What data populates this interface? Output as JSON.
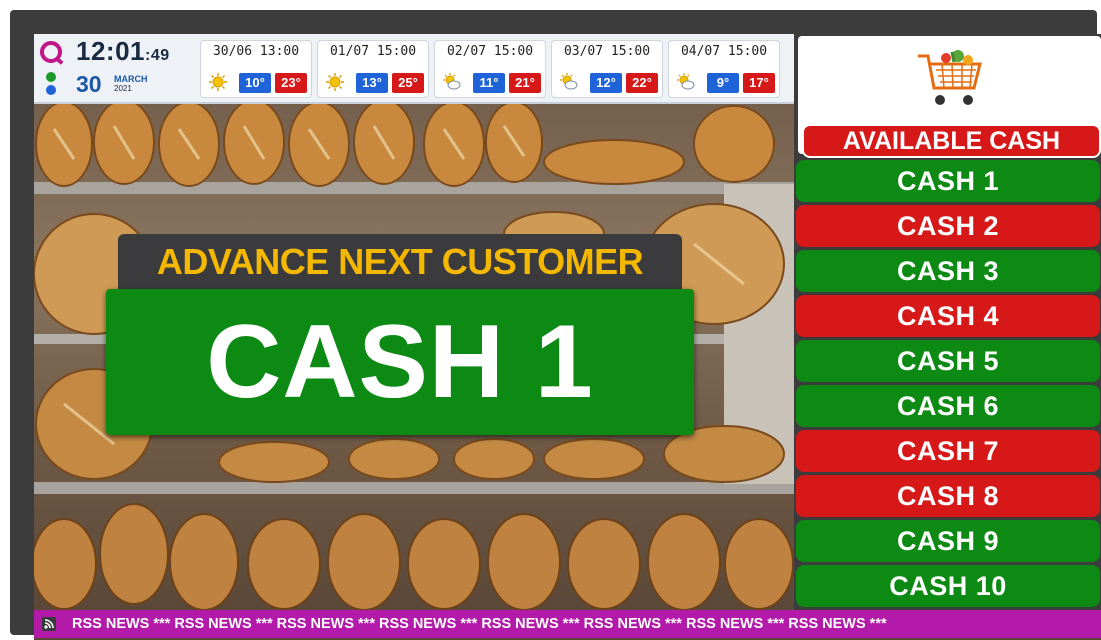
{
  "clock": {
    "time": "12:01",
    "seconds": ":49",
    "day": "30",
    "month": "MARCH",
    "year": "2021"
  },
  "forecast": [
    {
      "date": "30/06  13:00",
      "icon": "sun-icon",
      "min": "10°",
      "max": "23°"
    },
    {
      "date": "01/07  15:00",
      "icon": "sun-icon",
      "min": "13°",
      "max": "25°"
    },
    {
      "date": "02/07  15:00",
      "icon": "partly-cloudy-icon",
      "min": "11°",
      "max": "21°"
    },
    {
      "date": "03/07  15:00",
      "icon": "partly-cloudy-icon",
      "min": "12°",
      "max": "22°"
    },
    {
      "date": "04/07  15:00",
      "icon": "partly-cloudy-icon",
      "min": "9°",
      "max": "17°"
    }
  ],
  "announcement": {
    "title": "ADVANCE NEXT CUSTOMER",
    "value": "CASH  1"
  },
  "panel": {
    "title": "AVAILABLE CASH",
    "icon": "shopping-cart-icon",
    "cashes": [
      {
        "label": "CASH  1",
        "status": "green"
      },
      {
        "label": "CASH  2",
        "status": "red"
      },
      {
        "label": "CASH  3",
        "status": "green"
      },
      {
        "label": "CASH  4",
        "status": "red"
      },
      {
        "label": "CASH  5",
        "status": "green"
      },
      {
        "label": "CASH  6",
        "status": "green"
      },
      {
        "label": "CASH  7",
        "status": "red"
      },
      {
        "label": "CASH  8",
        "status": "red"
      },
      {
        "label": "CASH  9",
        "status": "green"
      },
      {
        "label": "CASH  10",
        "status": "green"
      }
    ]
  },
  "ticker": {
    "text": "RSS NEWS *** RSS NEWS *** RSS NEWS *** RSS NEWS *** RSS NEWS *** RSS NEWS *** RSS NEWS *** RSS NEWS ***"
  },
  "colors": {
    "green": "#0d8a14",
    "red": "#d71818",
    "title_yellow": "#f5b800",
    "ticker_magenta": "#b31aa9",
    "temp_blue": "#1f63d8"
  }
}
